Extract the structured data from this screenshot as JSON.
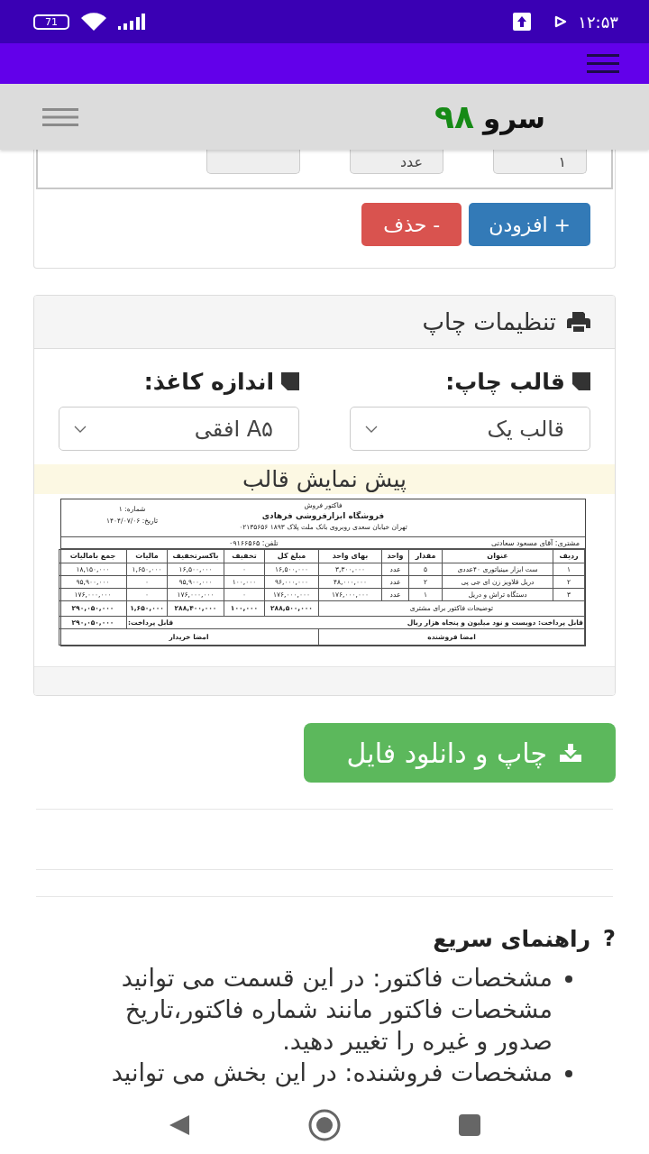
{
  "status_bar": {
    "battery": "71",
    "time": "۱۲:۵۳"
  },
  "site_header": {
    "logo_word": "سرو",
    "logo_number": "۹۸"
  },
  "item_card": {
    "fields": [
      {
        "kind": "text",
        "value": "۱"
      },
      {
        "kind": "text",
        "value": "عدد"
      },
      {
        "kind": "empty"
      }
    ],
    "buttons": [
      {
        "kind": "add",
        "label": "+ افزودن"
      },
      {
        "kind": "delete",
        "label": "- حذف"
      }
    ]
  },
  "print_settings": {
    "title": "تنظیمات چاپ",
    "selects": [
      {
        "label": "قالب چاپ:",
        "value": "قالب یک"
      },
      {
        "label": "اندازه کاغذ:",
        "value": "A۵ افقی"
      }
    ],
    "preview_title": "پیش نمایش قالب",
    "invoice": {
      "title": "فاکتور فروش",
      "shop": "فروشگاه ابزارفروشی فرهادی",
      "address": "تهران خیابان سعدی روبروی بانک ملت پلاک ۱۸۹۳ ۰۲۱۳۵۶۵۶",
      "number": "شماره: ۱",
      "date": "تاریخ: ۱۴۰۴/۰۷/۰۶",
      "customer": "مشتری: آقای مسعود سعادتی",
      "phone": "تلفن: ۰۹۱۶۶۵۶۵",
      "columns": [
        "ردیف",
        "عنوان",
        "مقدار",
        "واحد",
        "بهای واحد",
        "مبلغ کل",
        "تخفیف",
        "باکسرتخفیف",
        "مالیات",
        "جمع بامالیات"
      ],
      "rows": [
        [
          "۱",
          "ست ابزار مینیاتوری ۴۰عددی",
          "۵",
          "عدد",
          "۳,۳۰۰,۰۰۰",
          "۱۶,۵۰۰,۰۰۰",
          "۰",
          "۱۶,۵۰۰,۰۰۰",
          "۱,۶۵۰,۰۰۰",
          "۱۸,۱۵۰,۰۰۰"
        ],
        [
          "۲",
          "دریل قلاویز زن ای جی پی",
          "۲",
          "عدد",
          "۴۸,۰۰۰,۰۰۰",
          "۹۶,۰۰۰,۰۰۰",
          "۱۰۰,۰۰۰",
          "۹۵,۹۰۰,۰۰۰",
          "۰",
          "۹۵,۹۰۰,۰۰۰"
        ],
        [
          "۳",
          "دستگاه تراش و دریل",
          "۱",
          "عدد",
          "۱۷۶,۰۰۰,۰۰۰",
          "۱۷۶,۰۰۰,۰۰۰",
          "۰",
          "۱۷۶,۰۰۰,۰۰۰",
          "۰",
          "۱۷۶,۰۰۰,۰۰۰"
        ]
      ],
      "note": "توضیحات فاکتور برای مشتری",
      "totals": [
        "۲۸۸,۵۰۰,۰۰۰",
        "۱۰۰,۰۰۰",
        "۲۸۸,۴۰۰,۰۰۰",
        "۱,۶۵۰,۰۰۰",
        "۲۹۰,۰۵۰,۰۰۰"
      ],
      "payable_words": "قابل پرداخت: دویست و نود میلیون و پنجاه هزار ریال",
      "payable_label": "قابل پرداخت:",
      "payable_amount": "۲۹۰,۰۵۰,۰۰۰",
      "seller_signature": "امضا فروشنده",
      "buyer_signature": "امضا خریدار"
    }
  },
  "download_button": "چاپ و دانلود فایل",
  "help": {
    "icon": "?",
    "title": "راهنمای سریع",
    "items": [
      "مشخصات فاکتور: در این قسمت می توانید مشخصات فاکتور مانند شماره فاکتور،تاریخ صدور و غیره را تغییر دهید.",
      "مشخصات فروشنده: در این بخش می توانید"
    ]
  }
}
